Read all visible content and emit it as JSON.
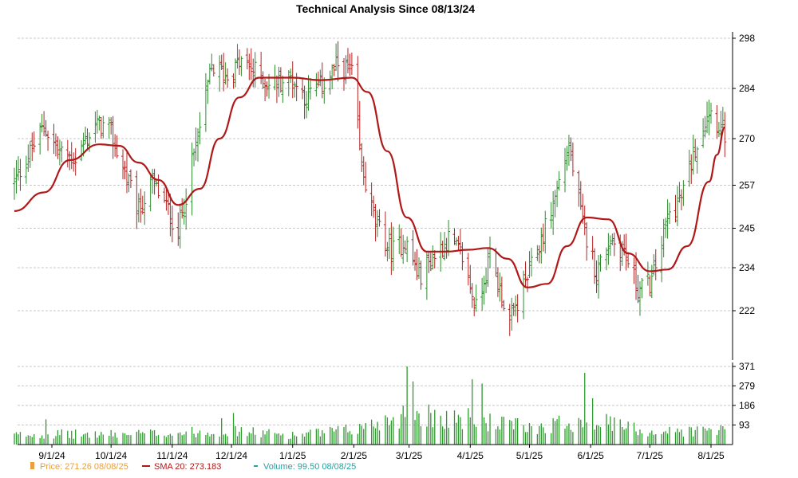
{
  "chart_data": {
    "type": "ohlc",
    "title": "Technical Analysis Since 08/13/24",
    "x_tick_labels": [
      "9/1/24",
      "10/1/24",
      "11/1/24",
      "12/1/24",
      "1/1/25",
      "2/1/25",
      "3/1/25",
      "4/1/25",
      "5/1/25",
      "6/1/25",
      "7/1/25",
      "8/1/25"
    ],
    "price_axis": {
      "ticks": [
        222,
        234,
        245,
        257,
        270,
        284,
        298
      ],
      "ylim": [
        212,
        298
      ]
    },
    "volume_axis": {
      "ticks": [
        93,
        186,
        279,
        371
      ],
      "ylim": [
        0,
        371
      ]
    },
    "price_series": [
      {
        "date": "8/13/24",
        "close": 257.9
      },
      {
        "date": "8/28/24",
        "close": 273.5
      },
      {
        "date": "9/5/24",
        "close": 266.0
      },
      {
        "date": "9/13/24",
        "close": 264.4
      },
      {
        "date": "9/23/24",
        "close": 274.0
      },
      {
        "date": "9/30/24",
        "close": 272.6
      },
      {
        "date": "10/7/24",
        "close": 262.0
      },
      {
        "date": "10/15/24",
        "close": 249.5
      },
      {
        "date": "10/22/24",
        "close": 258.0
      },
      {
        "date": "10/29/24",
        "close": 251.0
      },
      {
        "date": "11/4/24",
        "close": 244.0
      },
      {
        "date": "11/13/24",
        "close": 268.0
      },
      {
        "date": "11/21/24",
        "close": 290.0
      },
      {
        "date": "11/29/24",
        "close": 287.5
      },
      {
        "date": "12/6/24",
        "close": 291.5
      },
      {
        "date": "12/13/24",
        "close": 288.5
      },
      {
        "date": "12/20/24",
        "close": 285.0
      },
      {
        "date": "12/31/24",
        "close": 287.0
      },
      {
        "date": "1/8/25",
        "close": 281.5
      },
      {
        "date": "1/16/25",
        "close": 285.0
      },
      {
        "date": "1/24/25",
        "close": 290.5
      },
      {
        "date": "1/31/25",
        "close": 288.0
      },
      {
        "date": "2/5/25",
        "close": 262.0
      },
      {
        "date": "2/12/25",
        "close": 246.0
      },
      {
        "date": "2/20/25",
        "close": 238.5
      },
      {
        "date": "2/27/25",
        "close": 241.5
      },
      {
        "date": "3/6/25",
        "close": 231.5
      },
      {
        "date": "3/14/25",
        "close": 237.5
      },
      {
        "date": "3/21/25",
        "close": 242.0
      },
      {
        "date": "3/28/25",
        "close": 237.0
      },
      {
        "date": "4/4/25",
        "close": 222.5
      },
      {
        "date": "4/11/25",
        "close": 237.5
      },
      {
        "date": "4/21/25",
        "close": 218.5
      },
      {
        "date": "4/28/25",
        "close": 228.5
      },
      {
        "date": "5/6/25",
        "close": 240.0
      },
      {
        "date": "5/13/25",
        "close": 252.0
      },
      {
        "date": "5/21/25",
        "close": 268.0
      },
      {
        "date": "5/28/25",
        "close": 246.0
      },
      {
        "date": "6/4/25",
        "close": 232.5
      },
      {
        "date": "6/11/25",
        "close": 242.0
      },
      {
        "date": "6/18/25",
        "close": 238.5
      },
      {
        "date": "6/25/25",
        "close": 228.0
      },
      {
        "date": "7/2/25",
        "close": 230.0
      },
      {
        "date": "7/10/25",
        "close": 248.0
      },
      {
        "date": "7/17/25",
        "close": 253.5
      },
      {
        "date": "7/24/25",
        "close": 267.5
      },
      {
        "date": "7/31/25",
        "close": 278.5
      },
      {
        "date": "8/8/25",
        "close": 271.26
      }
    ],
    "sma20_series": [
      {
        "date": "8/13/24",
        "value": 249.8
      },
      {
        "date": "8/28/24",
        "value": 255.0
      },
      {
        "date": "9/10/24",
        "value": 264.0
      },
      {
        "date": "9/25/24",
        "value": 268.4
      },
      {
        "date": "10/5/24",
        "value": 268.0
      },
      {
        "date": "10/15/24",
        "value": 263.3
      },
      {
        "date": "10/25/24",
        "value": 258.5
      },
      {
        "date": "11/4/24",
        "value": 251.5
      },
      {
        "date": "11/15/24",
        "value": 256.0
      },
      {
        "date": "11/25/24",
        "value": 270.0
      },
      {
        "date": "12/5/24",
        "value": 281.5
      },
      {
        "date": "12/15/24",
        "value": 287.0
      },
      {
        "date": "1/1/25",
        "value": 287.0
      },
      {
        "date": "1/15/25",
        "value": 286.3
      },
      {
        "date": "1/31/25",
        "value": 287.0
      },
      {
        "date": "2/8/25",
        "value": 283.0
      },
      {
        "date": "2/18/25",
        "value": 266.5
      },
      {
        "date": "2/28/25",
        "value": 248.0
      },
      {
        "date": "3/10/25",
        "value": 238.5
      },
      {
        "date": "3/20/25",
        "value": 238.5
      },
      {
        "date": "3/31/25",
        "value": 239.0
      },
      {
        "date": "4/10/25",
        "value": 239.5
      },
      {
        "date": "4/20/25",
        "value": 236.5
      },
      {
        "date": "4/30/25",
        "value": 228.5
      },
      {
        "date": "5/10/25",
        "value": 229.5
      },
      {
        "date": "5/20/25",
        "value": 240.0
      },
      {
        "date": "5/30/25",
        "value": 248.0
      },
      {
        "date": "6/10/25",
        "value": 247.5
      },
      {
        "date": "6/20/25",
        "value": 238.0
      },
      {
        "date": "7/1/25",
        "value": 233.0
      },
      {
        "date": "7/10/25",
        "value": 233.5
      },
      {
        "date": "7/20/25",
        "value": 240.0
      },
      {
        "date": "7/31/25",
        "value": 258.0
      },
      {
        "date": "8/4/25",
        "value": 265.5
      },
      {
        "date": "8/8/25",
        "value": 273.183
      }
    ],
    "volume_profile": [
      {
        "date": "8/13/24",
        "value": 45
      },
      {
        "date": "9/1/24",
        "value": 50
      },
      {
        "date": "10/1/24",
        "value": 48
      },
      {
        "date": "11/1/24",
        "value": 55
      },
      {
        "date": "12/1/24",
        "value": 65
      },
      {
        "date": "1/1/25",
        "value": 45
      },
      {
        "date": "2/1/25",
        "value": 70
      },
      {
        "date": "3/1/25",
        "value": 150
      },
      {
        "date": "4/1/25",
        "value": 120
      },
      {
        "date": "5/1/25",
        "value": 80
      },
      {
        "date": "6/1/25",
        "value": 120
      },
      {
        "date": "7/1/25",
        "value": 60
      },
      {
        "date": "8/8/25",
        "value": 70
      }
    ],
    "volume_spikes": [
      {
        "date": "8/29/24",
        "value": 120
      },
      {
        "date": "11/26/24",
        "value": 125
      },
      {
        "date": "12/2/24",
        "value": 150
      },
      {
        "date": "2/28/25",
        "value": 371
      },
      {
        "date": "3/3/25",
        "value": 300
      },
      {
        "date": "4/2/25",
        "value": 310
      },
      {
        "date": "4/7/25",
        "value": 290
      },
      {
        "date": "4/25/25",
        "value": 125
      },
      {
        "date": "5/29/25",
        "value": 341
      },
      {
        "date": "6/2/25",
        "value": 220
      }
    ],
    "colors": {
      "up": "#2e8b2e",
      "down": "#b22222",
      "sma": "#b01818",
      "volume": "#2e9a2e",
      "grid": "#c8c8c8",
      "price_legend": "#e8a040",
      "volume_legend": "#2aa0a0"
    },
    "legend": {
      "price": "Price: 271.26  08/08/25",
      "sma": "SMA 20: 273.183",
      "volume": "Volume: 99.50  08/08/25"
    },
    "grid": true
  }
}
